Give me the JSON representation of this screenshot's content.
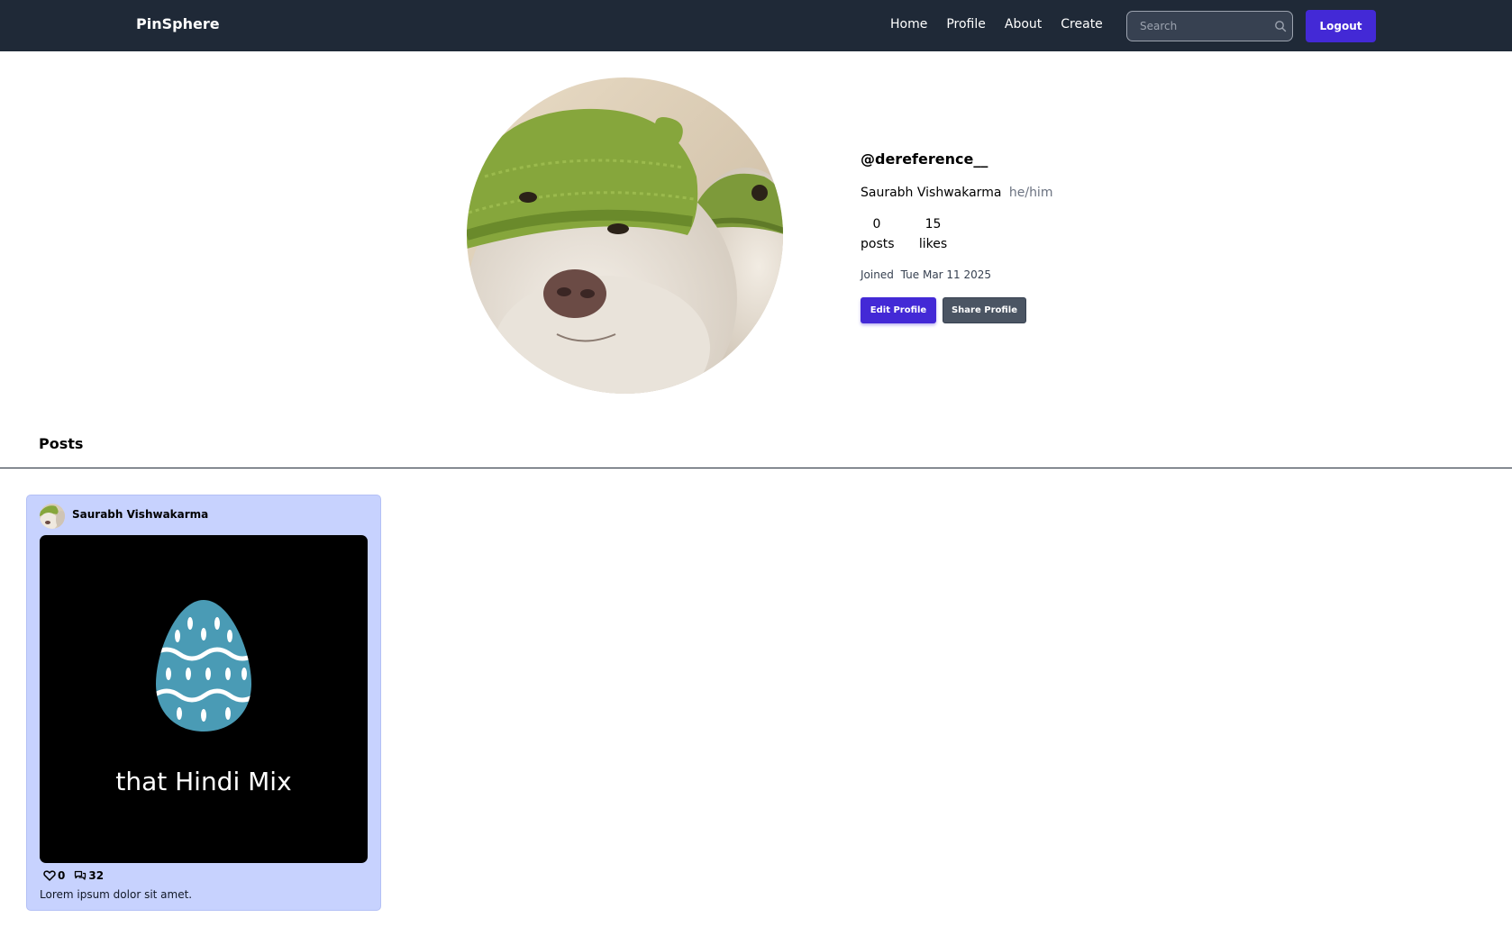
{
  "navbar": {
    "brand": "PinSphere",
    "links": [
      "Home",
      "Profile",
      "About",
      "Create"
    ],
    "search_placeholder": "Search",
    "logout_label": "Logout",
    "background": "#1f2937"
  },
  "profile": {
    "username": "@dereference__",
    "full_name": "Saurabh Vishwakarma",
    "pronouns": "he/him",
    "posts_count": "0",
    "posts_label": "posts",
    "likes_count": "15",
    "likes_label": "likes",
    "joined_label": "Joined",
    "joined_date": "Tue Mar 11 2025",
    "edit_label": "Edit Profile",
    "share_label": "Share Profile",
    "avatar_icon": "dog-with-green-knitted-hat-photo"
  },
  "posts_section": {
    "heading": "Posts",
    "items": [
      {
        "author": "Saurabh Vishwakarma",
        "image_text": "that Hindi Mix",
        "image_icon": "blue-easter-egg",
        "likes": "0",
        "comments": "32",
        "caption": "Lorem ipsum dolor sit amet.",
        "card_color": "#c7d2fe"
      }
    ]
  },
  "colors": {
    "accent": "#4329d6",
    "secondary_button": "#4b5563"
  }
}
